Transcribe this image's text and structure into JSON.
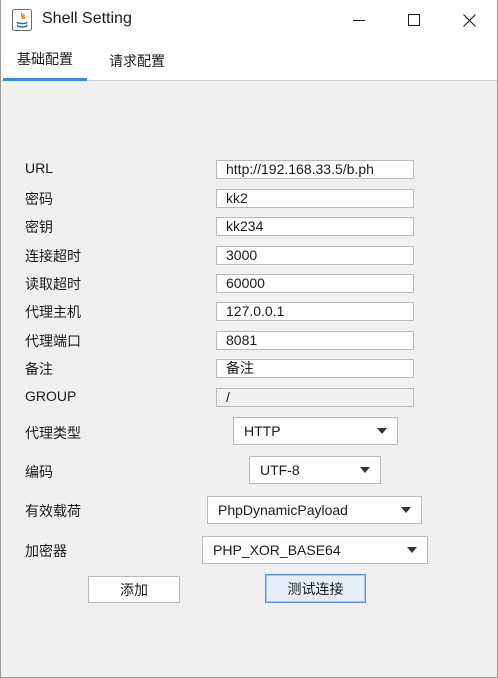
{
  "window": {
    "title": "Shell Setting"
  },
  "tabs": [
    {
      "label": "基础配置",
      "active": true
    },
    {
      "label": "请求配置",
      "active": false
    }
  ],
  "fields": [
    {
      "label": "URL",
      "value": "http://192.168.33.5/b.ph",
      "disabled": false
    },
    {
      "label": "密码",
      "value": "kk2",
      "disabled": false
    },
    {
      "label": "密钥",
      "value": "kk234",
      "disabled": false
    },
    {
      "label": "连接超时",
      "value": "3000",
      "disabled": false
    },
    {
      "label": "读取超时",
      "value": "60000",
      "disabled": false
    },
    {
      "label": "代理主机",
      "value": "127.0.0.1",
      "disabled": false
    },
    {
      "label": "代理端口",
      "value": "8081",
      "disabled": false
    },
    {
      "label": "备注",
      "value": "备注",
      "disabled": false
    },
    {
      "label": "GROUP",
      "value": "/",
      "disabled": true
    }
  ],
  "selects": [
    {
      "label": "代理类型",
      "value": "HTTP"
    },
    {
      "label": "编码",
      "value": "UTF-8"
    },
    {
      "label": "有效载荷",
      "value": "PhpDynamicPayload"
    },
    {
      "label": "加密器",
      "value": "PHP_XOR_BASE64"
    }
  ],
  "buttons": {
    "add": "添加",
    "test": "测试连接"
  },
  "colors": {
    "accent": "#3d8ad6",
    "window_bg": "#f0f0f0",
    "focus_border": "#5a90d6"
  }
}
